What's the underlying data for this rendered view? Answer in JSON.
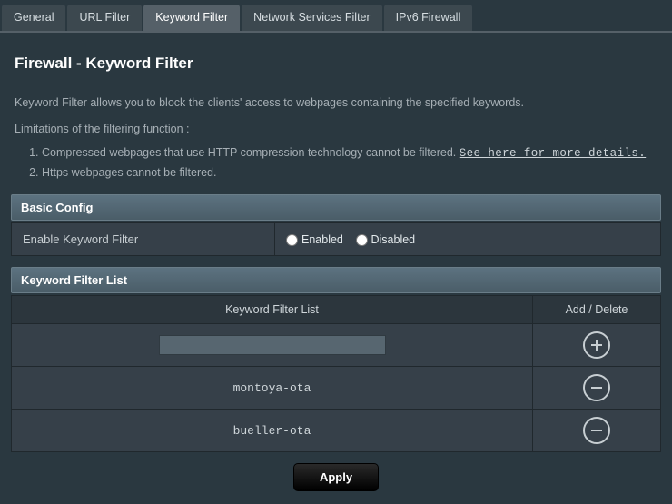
{
  "tabs": {
    "general": "General",
    "url_filter": "URL Filter",
    "keyword_filter": "Keyword Filter",
    "network_services_filter": "Network Services Filter",
    "ipv6_firewall": "IPv6 Firewall"
  },
  "title": "Firewall - Keyword Filter",
  "description": "Keyword Filter allows you to block the clients' access to webpages containing the specified keywords.",
  "limitations_heading": "Limitations of the filtering function :",
  "limits": {
    "l1a": "Compressed webpages that use HTTP compression technology cannot be filtered. ",
    "l1b": "See here for more details.",
    "l2": "Https webpages cannot be filtered."
  },
  "basic": {
    "section": "Basic Config",
    "enable_label": "Enable Keyword Filter",
    "enabled": "Enabled",
    "disabled": "Disabled"
  },
  "list": {
    "section": "Keyword Filter List",
    "col_list": "Keyword Filter List",
    "col_action": "Add / Delete",
    "input_value": "",
    "rows": {
      "r0": "montoya-ota",
      "r1": "bueller-ota"
    }
  },
  "apply": "Apply"
}
